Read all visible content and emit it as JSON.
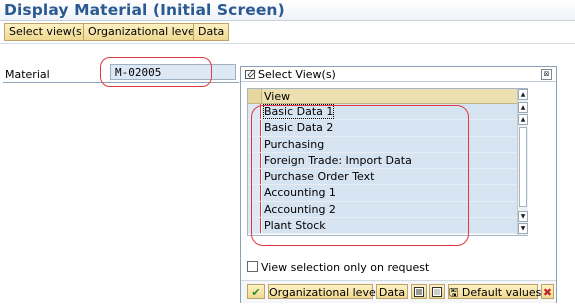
{
  "page": {
    "title": "Display Material (Initial Screen)"
  },
  "toolbar": {
    "select_views": "Select view(s)",
    "org_levels": "Organizational levels",
    "data": "Data"
  },
  "material": {
    "label": "Material",
    "value": "M-02005"
  },
  "dialog": {
    "title": "Select View(s)",
    "column_header": "View",
    "rows": [
      "Basic Data 1",
      "Basic Data 2",
      "Purchasing",
      "Foreign Trade: Import Data",
      "Purchase Order Text",
      "Accounting 1",
      "Accounting 2",
      "Plant Stock"
    ],
    "view_selection_label": "View selection only on request",
    "footer": {
      "org_levels": "Organizational levels",
      "data": "Data",
      "default_values": "Default values"
    }
  },
  "colors": {
    "title": "#2b5a92",
    "button_yellow": "#f3de9c",
    "highlight_red": "#e0383f",
    "selected_row": "#d6e3f1"
  }
}
